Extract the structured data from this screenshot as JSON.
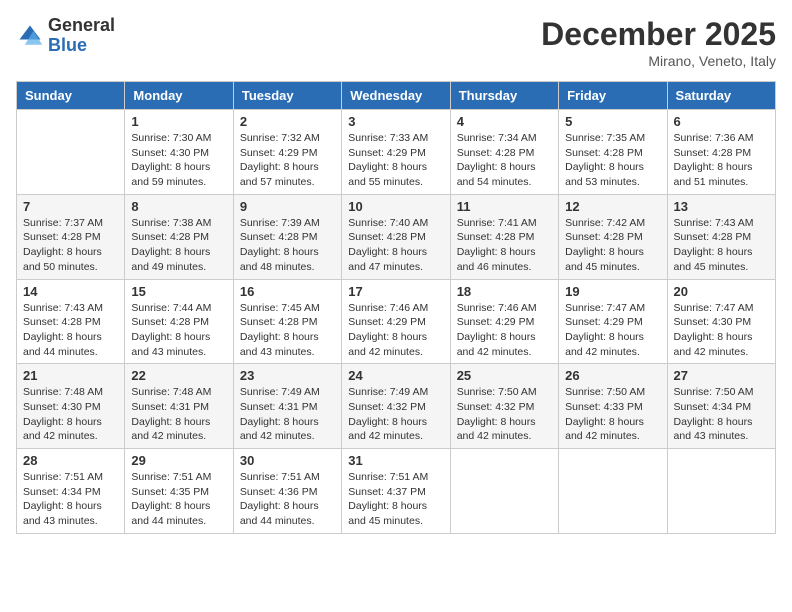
{
  "logo": {
    "general": "General",
    "blue": "Blue"
  },
  "header": {
    "month": "December 2025",
    "location": "Mirano, Veneto, Italy"
  },
  "weekdays": [
    "Sunday",
    "Monday",
    "Tuesday",
    "Wednesday",
    "Thursday",
    "Friday",
    "Saturday"
  ],
  "weeks": [
    [
      {
        "day": null,
        "info": null
      },
      {
        "day": "1",
        "info": "Sunrise: 7:30 AM\nSunset: 4:30 PM\nDaylight: 8 hours\nand 59 minutes."
      },
      {
        "day": "2",
        "info": "Sunrise: 7:32 AM\nSunset: 4:29 PM\nDaylight: 8 hours\nand 57 minutes."
      },
      {
        "day": "3",
        "info": "Sunrise: 7:33 AM\nSunset: 4:29 PM\nDaylight: 8 hours\nand 55 minutes."
      },
      {
        "day": "4",
        "info": "Sunrise: 7:34 AM\nSunset: 4:28 PM\nDaylight: 8 hours\nand 54 minutes."
      },
      {
        "day": "5",
        "info": "Sunrise: 7:35 AM\nSunset: 4:28 PM\nDaylight: 8 hours\nand 53 minutes."
      },
      {
        "day": "6",
        "info": "Sunrise: 7:36 AM\nSunset: 4:28 PM\nDaylight: 8 hours\nand 51 minutes."
      }
    ],
    [
      {
        "day": "7",
        "info": "Sunrise: 7:37 AM\nSunset: 4:28 PM\nDaylight: 8 hours\nand 50 minutes."
      },
      {
        "day": "8",
        "info": "Sunrise: 7:38 AM\nSunset: 4:28 PM\nDaylight: 8 hours\nand 49 minutes."
      },
      {
        "day": "9",
        "info": "Sunrise: 7:39 AM\nSunset: 4:28 PM\nDaylight: 8 hours\nand 48 minutes."
      },
      {
        "day": "10",
        "info": "Sunrise: 7:40 AM\nSunset: 4:28 PM\nDaylight: 8 hours\nand 47 minutes."
      },
      {
        "day": "11",
        "info": "Sunrise: 7:41 AM\nSunset: 4:28 PM\nDaylight: 8 hours\nand 46 minutes."
      },
      {
        "day": "12",
        "info": "Sunrise: 7:42 AM\nSunset: 4:28 PM\nDaylight: 8 hours\nand 45 minutes."
      },
      {
        "day": "13",
        "info": "Sunrise: 7:43 AM\nSunset: 4:28 PM\nDaylight: 8 hours\nand 45 minutes."
      }
    ],
    [
      {
        "day": "14",
        "info": "Sunrise: 7:43 AM\nSunset: 4:28 PM\nDaylight: 8 hours\nand 44 minutes."
      },
      {
        "day": "15",
        "info": "Sunrise: 7:44 AM\nSunset: 4:28 PM\nDaylight: 8 hours\nand 43 minutes."
      },
      {
        "day": "16",
        "info": "Sunrise: 7:45 AM\nSunset: 4:28 PM\nDaylight: 8 hours\nand 43 minutes."
      },
      {
        "day": "17",
        "info": "Sunrise: 7:46 AM\nSunset: 4:29 PM\nDaylight: 8 hours\nand 42 minutes."
      },
      {
        "day": "18",
        "info": "Sunrise: 7:46 AM\nSunset: 4:29 PM\nDaylight: 8 hours\nand 42 minutes."
      },
      {
        "day": "19",
        "info": "Sunrise: 7:47 AM\nSunset: 4:29 PM\nDaylight: 8 hours\nand 42 minutes."
      },
      {
        "day": "20",
        "info": "Sunrise: 7:47 AM\nSunset: 4:30 PM\nDaylight: 8 hours\nand 42 minutes."
      }
    ],
    [
      {
        "day": "21",
        "info": "Sunrise: 7:48 AM\nSunset: 4:30 PM\nDaylight: 8 hours\nand 42 minutes."
      },
      {
        "day": "22",
        "info": "Sunrise: 7:48 AM\nSunset: 4:31 PM\nDaylight: 8 hours\nand 42 minutes."
      },
      {
        "day": "23",
        "info": "Sunrise: 7:49 AM\nSunset: 4:31 PM\nDaylight: 8 hours\nand 42 minutes."
      },
      {
        "day": "24",
        "info": "Sunrise: 7:49 AM\nSunset: 4:32 PM\nDaylight: 8 hours\nand 42 minutes."
      },
      {
        "day": "25",
        "info": "Sunrise: 7:50 AM\nSunset: 4:32 PM\nDaylight: 8 hours\nand 42 minutes."
      },
      {
        "day": "26",
        "info": "Sunrise: 7:50 AM\nSunset: 4:33 PM\nDaylight: 8 hours\nand 42 minutes."
      },
      {
        "day": "27",
        "info": "Sunrise: 7:50 AM\nSunset: 4:34 PM\nDaylight: 8 hours\nand 43 minutes."
      }
    ],
    [
      {
        "day": "28",
        "info": "Sunrise: 7:51 AM\nSunset: 4:34 PM\nDaylight: 8 hours\nand 43 minutes."
      },
      {
        "day": "29",
        "info": "Sunrise: 7:51 AM\nSunset: 4:35 PM\nDaylight: 8 hours\nand 44 minutes."
      },
      {
        "day": "30",
        "info": "Sunrise: 7:51 AM\nSunset: 4:36 PM\nDaylight: 8 hours\nand 44 minutes."
      },
      {
        "day": "31",
        "info": "Sunrise: 7:51 AM\nSunset: 4:37 PM\nDaylight: 8 hours\nand 45 minutes."
      },
      {
        "day": null,
        "info": null
      },
      {
        "day": null,
        "info": null
      },
      {
        "day": null,
        "info": null
      }
    ]
  ]
}
